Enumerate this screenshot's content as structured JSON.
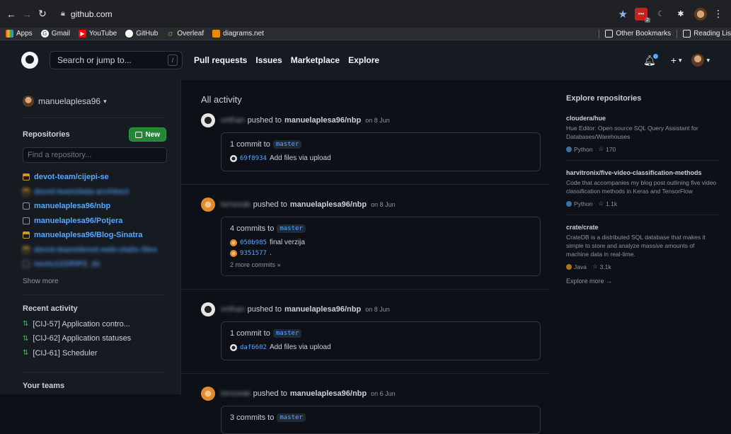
{
  "browser": {
    "url": "github.com",
    "bookmarks": [
      "Apps",
      "Gmail",
      "YouTube",
      "GitHub",
      "Overleaf",
      "diagrams.net"
    ],
    "bookmarks_right": [
      "Other Bookmarks",
      "Reading Lis"
    ],
    "badge_count": "2"
  },
  "header": {
    "search_placeholder": "Search or jump to...",
    "slash_key": "/",
    "nav": [
      "Pull requests",
      "Issues",
      "Marketplace",
      "Explore"
    ],
    "plus_label": "+",
    "caret": "▾"
  },
  "sidebar": {
    "username": "manuelaplesa96",
    "repos_title": "Repositories",
    "new_button": "New",
    "find_placeholder": "Find a repository...",
    "repos": [
      {
        "name": "devot-team/cijepi-se",
        "private": true,
        "blurred": false
      },
      {
        "name": "devot-team/data-architect",
        "private": true,
        "blurred": true
      },
      {
        "name": "manuelaplesa96/nbp",
        "private": false,
        "blurred": false
      },
      {
        "name": "manuelaplesa96/Potjera",
        "private": false,
        "blurred": false
      },
      {
        "name": "manuelaplesa96/Blog-Sinatra",
        "private": true,
        "blurred": false
      },
      {
        "name": "devot-team/devot-web-static-files",
        "private": true,
        "blurred": true
      },
      {
        "name": "nesto123/RIP2_dz",
        "private": false,
        "blurred": true
      }
    ],
    "show_more": "Show more",
    "recent_title": "Recent activity",
    "recent": [
      "[CIJ-57] Application contro...",
      "[CIJ-62] Application statuses",
      "[CIJ-61] Scheduler"
    ],
    "teams_title": "Your teams"
  },
  "feed": {
    "title": "All activity",
    "events": [
      {
        "user": "ortihan",
        "action": "pushed to",
        "repo": "manuelaplesa96/nbp",
        "date": "on 8 Jun",
        "summary": "1 commit to",
        "branch": "master",
        "commits": [
          {
            "sha": "69f8934",
            "msg": "Add files via upload"
          }
        ],
        "more": ""
      },
      {
        "user": "lornovak",
        "action": "pushed to",
        "repo": "manuelaplesa96/nbp",
        "date": "on 8 Jun",
        "summary": "4 commits to",
        "branch": "master",
        "commits": [
          {
            "sha": "050b985",
            "msg": "final verzija"
          },
          {
            "sha": "9351577",
            "msg": "."
          }
        ],
        "more": "2 more commits »"
      },
      {
        "user": "ortihan",
        "action": "pushed to",
        "repo": "manuelaplesa96/nbp",
        "date": "on 8 Jun",
        "summary": "1 commit to",
        "branch": "master",
        "commits": [
          {
            "sha": "daf6602",
            "msg": "Add files via upload"
          }
        ],
        "more": ""
      },
      {
        "user": "lornovak",
        "action": "pushed to",
        "repo": "manuelaplesa96/nbp",
        "date": "on 6 Jun",
        "summary": "3 commits to",
        "branch": "master",
        "commits": [],
        "more": ""
      }
    ]
  },
  "explore": {
    "title": "Explore repositories",
    "repos": [
      {
        "name": "cloudera/hue",
        "desc": "Hue Editor: Open source SQL Query Assistant for Databases/Warehouses",
        "lang": "Python",
        "lang_color": "#3572A5",
        "stars": "170"
      },
      {
        "name": "harvitronix/five-video-classification-methods",
        "desc": "Code that accompanies my blog post outlining five video classification methods in Keras and TensorFlow",
        "lang": "Python",
        "lang_color": "#3572A5",
        "stars": "1.1k"
      },
      {
        "name": "crate/crate",
        "desc": "CrateDB is a distributed SQL database that makes it simple to store and analyze massive amounts of machine data in real-time.",
        "lang": "Java",
        "lang_color": "#b07219",
        "stars": "3.1k"
      }
    ],
    "more": "Explore more →"
  }
}
